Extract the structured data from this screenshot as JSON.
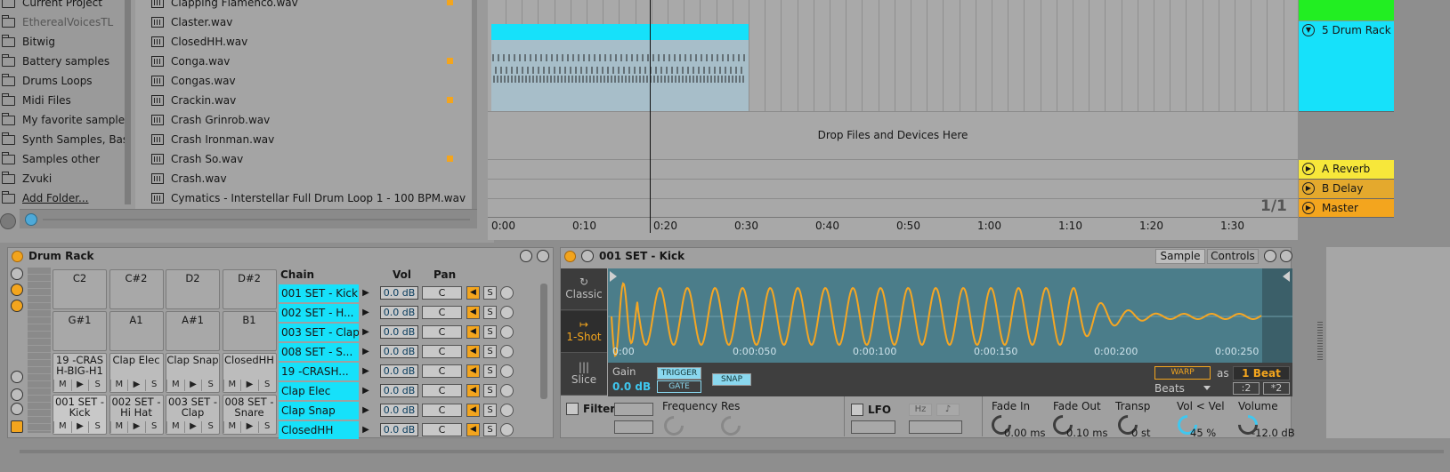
{
  "browser": {
    "places": [
      "Current Project",
      "EtherealVoicesTL",
      "Bitwig",
      "Battery samples",
      "Drums Loops",
      "Midi Files",
      "My favorite samples",
      "Synth Samples, Bass",
      "Samples other",
      "Zvuki",
      "Add Folder..."
    ],
    "files": [
      {
        "name": "Clapping Flamenco.wav",
        "dot": true
      },
      {
        "name": "Claster.wav",
        "dot": false
      },
      {
        "name": "ClosedHH.wav",
        "dot": false
      },
      {
        "name": "Conga.wav",
        "dot": true
      },
      {
        "name": "Congas.wav",
        "dot": false
      },
      {
        "name": "Crackin.wav",
        "dot": true
      },
      {
        "name": "Crash Grinrob.wav",
        "dot": false
      },
      {
        "name": "Crash Ironman.wav",
        "dot": false
      },
      {
        "name": "Crash So.wav",
        "dot": true
      },
      {
        "name": "Crash.wav",
        "dot": false
      },
      {
        "name": "Cymatics - Interstellar Full Drum Loop 1 - 100 BPM.wav",
        "dot": false
      }
    ]
  },
  "arrangement": {
    "drop_text": "Drop Files and Devices Here",
    "ruler": [
      "0:00",
      "0:10",
      "0:20",
      "0:30",
      "0:40",
      "0:50",
      "1:00",
      "1:10",
      "1:20",
      "1:30"
    ],
    "pager": "1/1"
  },
  "tracks": {
    "drum_rack": "5 Drum Rack",
    "a_reverb": "A Reverb",
    "b_delay": "B Delay",
    "master": "Master",
    "colors": {
      "green": "#22ee22",
      "cyan": "#16e1fa",
      "yellow": "#f7e73a",
      "orange": "#f3a51e"
    }
  },
  "drum_rack": {
    "title": "Drum Rack",
    "pads_row1": [
      "C2",
      "C#2",
      "D2",
      "D#2"
    ],
    "pads_row2": [
      "G#1",
      "A1",
      "A#1",
      "B1"
    ],
    "pads_row3": [
      "19 -CRAS H-BIG-H1",
      "Clap Elec",
      "Clap Snap",
      "ClosedHH"
    ],
    "pads_row4": [
      "001 SET - Kick",
      "002 SET - Hi Hat",
      "003 SET - Clap",
      "008 SET - Snare"
    ],
    "ms": [
      "M",
      "▶",
      "S"
    ],
    "chain_header": {
      "chain": "Chain",
      "vol": "Vol",
      "pan": "Pan"
    },
    "chains": [
      {
        "name": "001 SET - Kick",
        "vol": "0.0 dB",
        "pan": "C"
      },
      {
        "name": "002 SET - H...",
        "vol": "0.0 dB",
        "pan": "C"
      },
      {
        "name": "003 SET - Clap",
        "vol": "0.0 dB",
        "pan": "C"
      },
      {
        "name": "008 SET - S...",
        "vol": "0.0 dB",
        "pan": "C"
      },
      {
        "name": "19 -CRASH...",
        "vol": "0.0 dB",
        "pan": "C"
      },
      {
        "name": "Clap Elec",
        "vol": "0.0 dB",
        "pan": "C"
      },
      {
        "name": "Clap Snap",
        "vol": "0.0 dB",
        "pan": "C"
      },
      {
        "name": "ClosedHH",
        "vol": "0.0 dB",
        "pan": "C"
      }
    ]
  },
  "simpler": {
    "title": "001 SET - Kick",
    "tab_sample": "Sample",
    "tab_controls": "Controls",
    "modes": [
      "Classic",
      "1-Shot",
      "Slice"
    ],
    "time_labels": [
      "0:00",
      "0:00:050",
      "0:00:100",
      "0:00:150",
      "0:00:200",
      "0:00:250"
    ],
    "gain_label": "Gain",
    "gain_value": "0.0 dB",
    "trigger": "TRIGGER",
    "gate": "GATE",
    "snap": "SNAP",
    "warp": "WARP",
    "as": "as",
    "beat": "1 Beat",
    "beats": "Beats",
    "half": ":2",
    "double": "*2",
    "filter": "Filter",
    "frequency": "Frequency",
    "res": "Res",
    "lfo": "LFO",
    "hz": "Hz",
    "fade_in_label": "Fade In",
    "fade_in": "0.00 ms",
    "fade_out_label": "Fade Out",
    "fade_out": "0.10 ms",
    "transp_label": "Transp",
    "transp": "0 st",
    "vol_vel_label": "Vol < Vel",
    "vol_vel": "45 %",
    "volume_label": "Volume",
    "volume": "-12.0 dB"
  }
}
